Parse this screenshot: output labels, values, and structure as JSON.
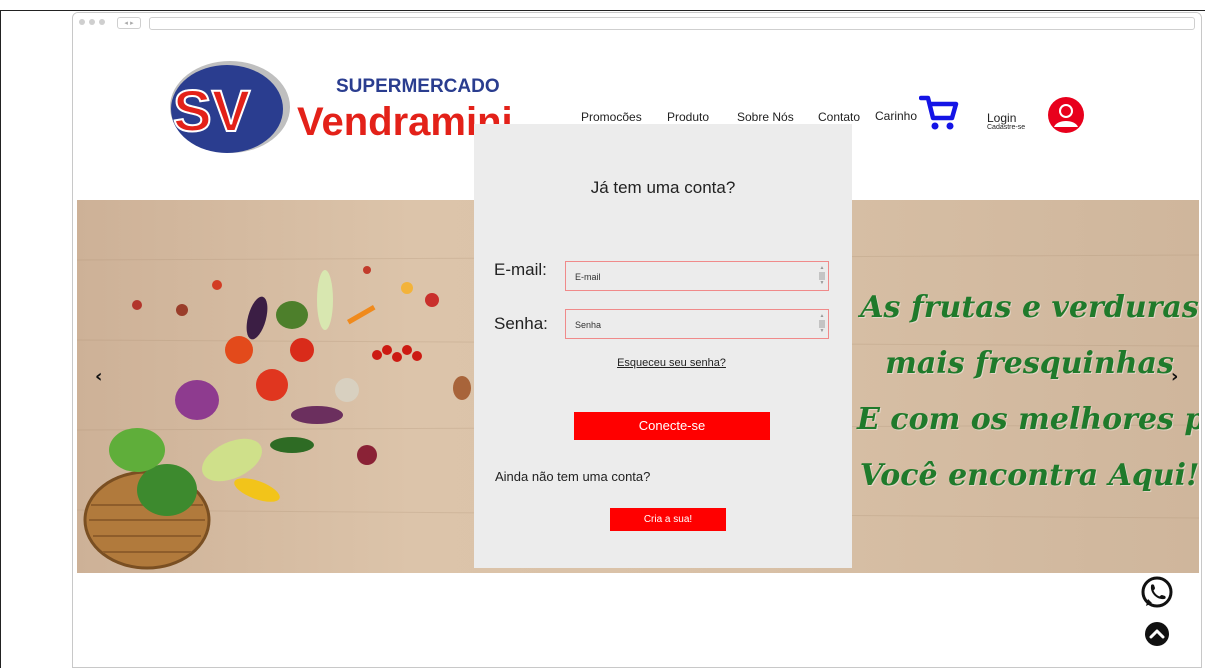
{
  "brand": {
    "initials": "SV",
    "tagline": "SUPERMERCADO",
    "name": "Vendramini",
    "colors": {
      "blue": "#2a3d8f",
      "red": "#e32119"
    }
  },
  "nav": {
    "items": [
      "Promocões",
      "Produto",
      "Sobre Nós",
      "Contato",
      "Carinho"
    ],
    "login": "Login",
    "signup": "Cadastre-se"
  },
  "banner": {
    "slogan": [
      "As frutas e verduras",
      "mais fresquinhas",
      "E com os melhores preços",
      "Você encontra Aqui!"
    ],
    "prev_arrow": "‹",
    "next_arrow": "›"
  },
  "login_modal": {
    "title": "Já tem uma conta?",
    "email_label": "E-mail:",
    "email_placeholder": "E-mail",
    "password_label": "Senha:",
    "password_placeholder": "Senha",
    "forgot": "Esqueceu seu senha?",
    "connect_button": "Conecte-se",
    "no_account": "Ainda não tem uma conta?",
    "create_button": "Cria a sua!"
  },
  "colors": {
    "accent_red": "#ff0000",
    "cart_blue": "#1414e6",
    "user_red": "#e8001c",
    "slogan_green": "#1f7a2b"
  },
  "icons": [
    "cart-icon",
    "user-icon",
    "whatsapp-icon",
    "chevron-up-icon"
  ]
}
